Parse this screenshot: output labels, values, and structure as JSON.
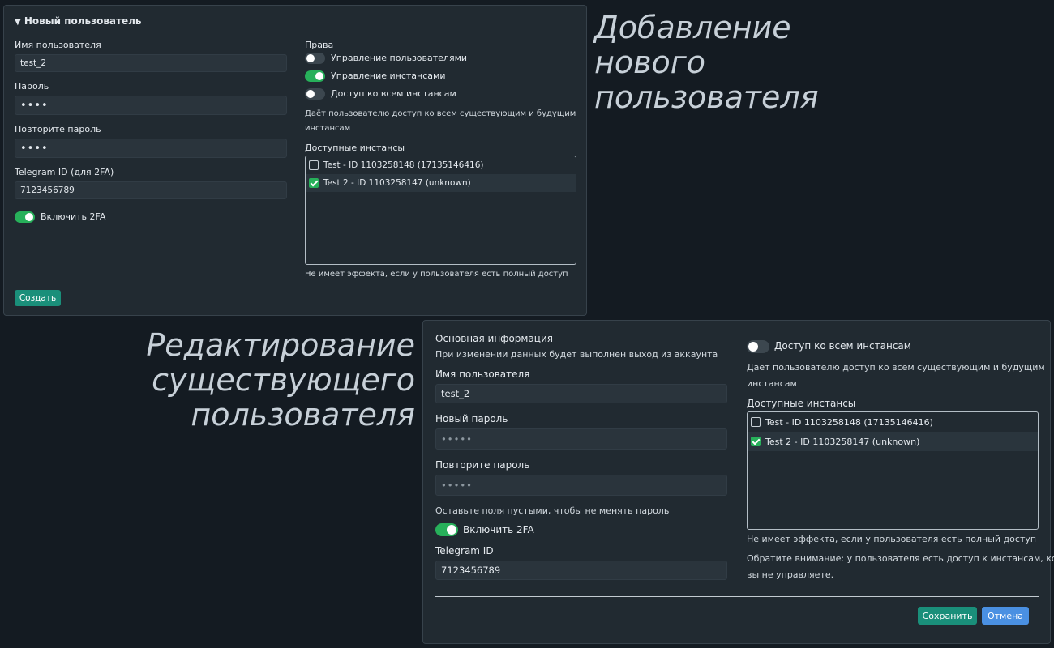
{
  "new_user": {
    "header": "Новый пользователь",
    "username_label": "Имя пользователя",
    "username_value": "test_2",
    "password_label": "Пароль",
    "password_value": "••••",
    "repeat_password_label": "Повторите пароль",
    "repeat_password_value": "••••",
    "telegram_label": "Telegram ID (для 2FA)",
    "telegram_value": "7123456789",
    "twofa_label": "Включить 2FA",
    "twofa_on": true,
    "rights_label": "Права",
    "rights": [
      {
        "label": "Управление пользователями",
        "on": false
      },
      {
        "label": "Управление инстансами",
        "on": true
      },
      {
        "label": "Доступ ко всем инстансам",
        "on": false
      }
    ],
    "full_access_hint_line1": "Даёт пользователю доступ ко всем существующим и будущим",
    "full_access_hint_line2": "инстансам",
    "instances_label": "Доступные инстансы",
    "instances": [
      {
        "label": "Test - ID 1103258148 (17135146416)",
        "checked": false
      },
      {
        "label": "Test 2 - ID 1103258147 (unknown)",
        "checked": true
      }
    ],
    "no_effect_note": "Не имеет эффекта, если у пользователя есть полный доступ",
    "create_button": "Создать"
  },
  "headings": {
    "add_user": [
      "Добавление",
      "нового",
      "пользователя"
    ],
    "edit_user": [
      "Редактирование",
      "существующего",
      "пользователя"
    ]
  },
  "edit_user": {
    "section_title": "Основная информация",
    "logout_note": "При изменении данных будет выполнен выход из аккаунта",
    "username_label": "Имя пользователя",
    "username_value": "test_2",
    "new_password_label": "Новый пароль",
    "new_password_placeholder": "•••••",
    "repeat_password_label": "Повторите пароль",
    "repeat_password_placeholder": "•••••",
    "empty_password_note": "Оставьте поля пустыми, чтобы не менять пароль",
    "twofa_label": "Включить 2FA",
    "twofa_on": true,
    "telegram_label": "Telegram ID",
    "telegram_value": "7123456789",
    "full_access_label": "Доступ ко всем инстансам",
    "full_access_on": false,
    "full_access_hint_line1": "Даёт пользователю доступ ко всем существующим и будущим",
    "full_access_hint_line2": "инстансам",
    "instances_label": "Доступные инстансы",
    "instances": [
      {
        "label": "Test - ID 1103258148 (17135146416)",
        "checked": false
      },
      {
        "label": "Test 2 - ID 1103258147 (unknown)",
        "checked": true
      }
    ],
    "no_effect_note": "Не имеет эффекта, если у пользователя есть полный доступ",
    "warning_line1": "Обратите внимание: у пользователя есть доступ к инстансам, которыми",
    "warning_line2": "вы не управляете.",
    "save_button": "Сохранить",
    "cancel_button": "Отмена"
  },
  "colors": {
    "background": "#141b22",
    "panel": "#212a31",
    "toggle_on": "#27b05a",
    "teal_button": "#1a8f7a",
    "blue_button": "#4a90e2"
  }
}
